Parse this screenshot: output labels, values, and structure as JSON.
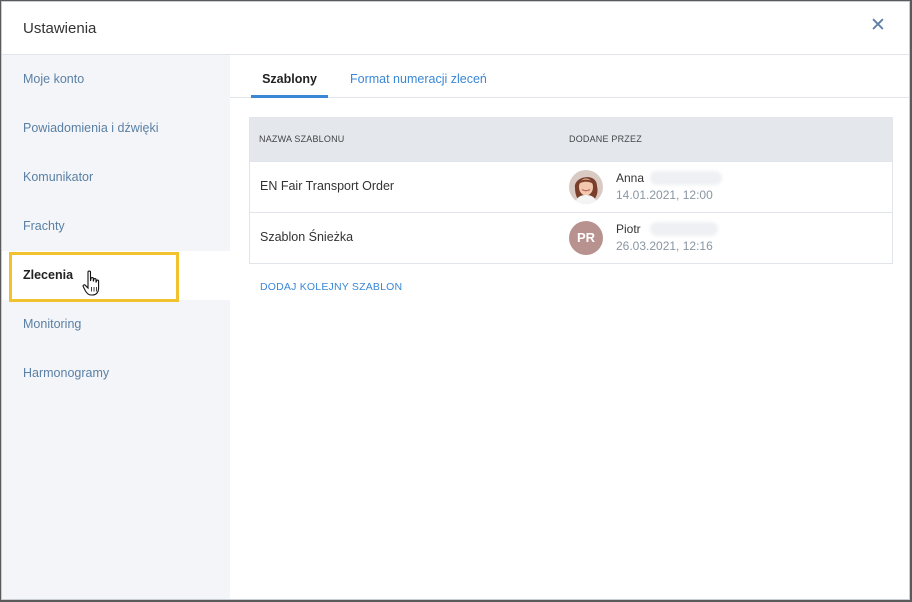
{
  "dialog": {
    "title": "Ustawienia",
    "close_glyph": "✕"
  },
  "sidebar": {
    "items": [
      {
        "label": "Moje konto"
      },
      {
        "label": "Powiadomienia i dźwięki"
      },
      {
        "label": "Komunikator"
      },
      {
        "label": "Frachty"
      },
      {
        "label": "Zlecenia",
        "active": true
      },
      {
        "label": "Monitoring"
      },
      {
        "label": "Harmonogramy"
      }
    ]
  },
  "tabs": [
    {
      "label": "Szablony",
      "active": true
    },
    {
      "label": "Format numeracji zleceń",
      "active": false
    }
  ],
  "table": {
    "columns": [
      "NAZWA SZABLONU",
      "DODANE PRZEZ"
    ],
    "rows": [
      {
        "name": "EN Fair Transport Order",
        "author": "Anna",
        "date": "14.01.2021, 12:00",
        "avatar": "photo"
      },
      {
        "name": "Szablon Śnieżka",
        "author": "Piotr",
        "initials": "PR",
        "date": "26.03.2021, 12:16",
        "avatar": "initials"
      }
    ]
  },
  "add_template_label": "DODAJ KOLEJNY SZABLON",
  "colors": {
    "accent": "#3a87d6",
    "highlight": "#f2c12e",
    "sidebar_bg": "#f3f5f8",
    "avatar_initials_bg": "#b8928e"
  }
}
